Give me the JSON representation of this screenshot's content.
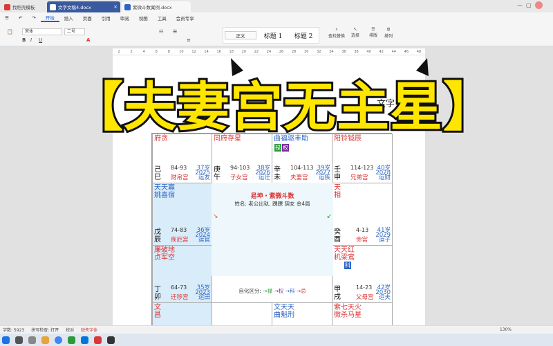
{
  "tabs": [
    {
      "label": "找稻壳模板",
      "color": "#d93838"
    },
    {
      "label": "文字文稿4.docx",
      "color": "#2b63c6"
    },
    {
      "label": "紫微斗数案例.docx",
      "color": "#2b63c6"
    }
  ],
  "menu": [
    "开始",
    "插入",
    "页面",
    "引用",
    "审阅",
    "视图",
    "工具",
    "会员专享"
  ],
  "ribbon": {
    "font": "宋体",
    "size": "二号",
    "styles": [
      "正文",
      "标题 1",
      "标题 2"
    ],
    "tools": [
      "查找替换",
      "选择",
      "排版",
      "排列"
    ]
  },
  "overlay_title": "【夫妻宫无主星】",
  "doc_fragment": "文字",
  "chart": {
    "center_title": "易坤・紫微斗数",
    "center_info": "姓名: 老公出轨, 踝踝 阴女 金4局",
    "hua_label": "自化区分:",
    "hua": [
      "禄",
      "权",
      "科",
      "忌"
    ],
    "hua_colors": [
      "#2a9a3a",
      "#7a2a9e",
      "#2b63c6",
      "#d93333"
    ],
    "palaces": {
      "si": {
        "top": "府贪",
        "gz": [
          "己",
          "巳"
        ],
        "range": "84-93",
        "age": "37岁",
        "year": "2025",
        "palace": "财帛宫",
        "yun": "运友"
      },
      "wu": {
        "top": "同府存星",
        "gz": [
          "庚",
          "午"
        ],
        "range": "94-103",
        "age": "38岁",
        "year": "2026",
        "palace": "子女宫",
        "yun": "运迁"
      },
      "wei": {
        "top": "曲福驱丰助",
        "hua": "禄权",
        "gz": [
          "辛",
          "未"
        ],
        "range": "104-113",
        "age": "39岁",
        "year": "2027",
        "palace": "夫妻宫",
        "yun": "运疾"
      },
      "shen": {
        "top": "阳铃钺辰",
        "gz": [
          "壬",
          "申"
        ],
        "range": "114-123",
        "age": "40岁",
        "year": "2028",
        "palace": "兄弟宫",
        "yun": "运财"
      },
      "chen": {
        "stars": [
          "天天寡",
          "姚喜宿"
        ],
        "gz": [
          "戊",
          "辰"
        ],
        "range": "74-83",
        "age": "36岁",
        "year": "2024",
        "palace": "疾厄宫",
        "yun": "运官"
      },
      "you": {
        "stars": [
          "天",
          "相"
        ],
        "gz": [
          "癸",
          "酉"
        ],
        "range": "4-13",
        "age": "41岁",
        "year": "2029",
        "palace": "命宫",
        "yun": "运子"
      },
      "mao": {
        "stars": [
          "廉破地",
          "贞军空"
        ],
        "gz": [
          "丁",
          "卯"
        ],
        "range": "64-73",
        "age": "35岁",
        "year": "2023",
        "palace": "迁移宫",
        "yun": "运田"
      },
      "xu": {
        "stars": [
          "天天红",
          "机梁鸾"
        ],
        "hua": "科",
        "gz": [
          "甲",
          "戌"
        ],
        "range": "14-23",
        "age": "42岁",
        "year": "2030",
        "palace": "父母宫",
        "yun": "运夫"
      },
      "yin": {
        "stars": [
          "文",
          "昌"
        ]
      },
      "chou": {
        "stars": [
          "文天天",
          "曲魁刑"
        ]
      },
      "zi": {
        "stars": [
          "紫七天火",
          "微杀马星"
        ]
      },
      "hai": {
        "stars": []
      }
    }
  },
  "status": {
    "words": "字数: 5923",
    "spell": "拼写检查: 打开",
    "proof": "校对",
    "font_missing": "缺失字体",
    "zoom": "130%"
  }
}
